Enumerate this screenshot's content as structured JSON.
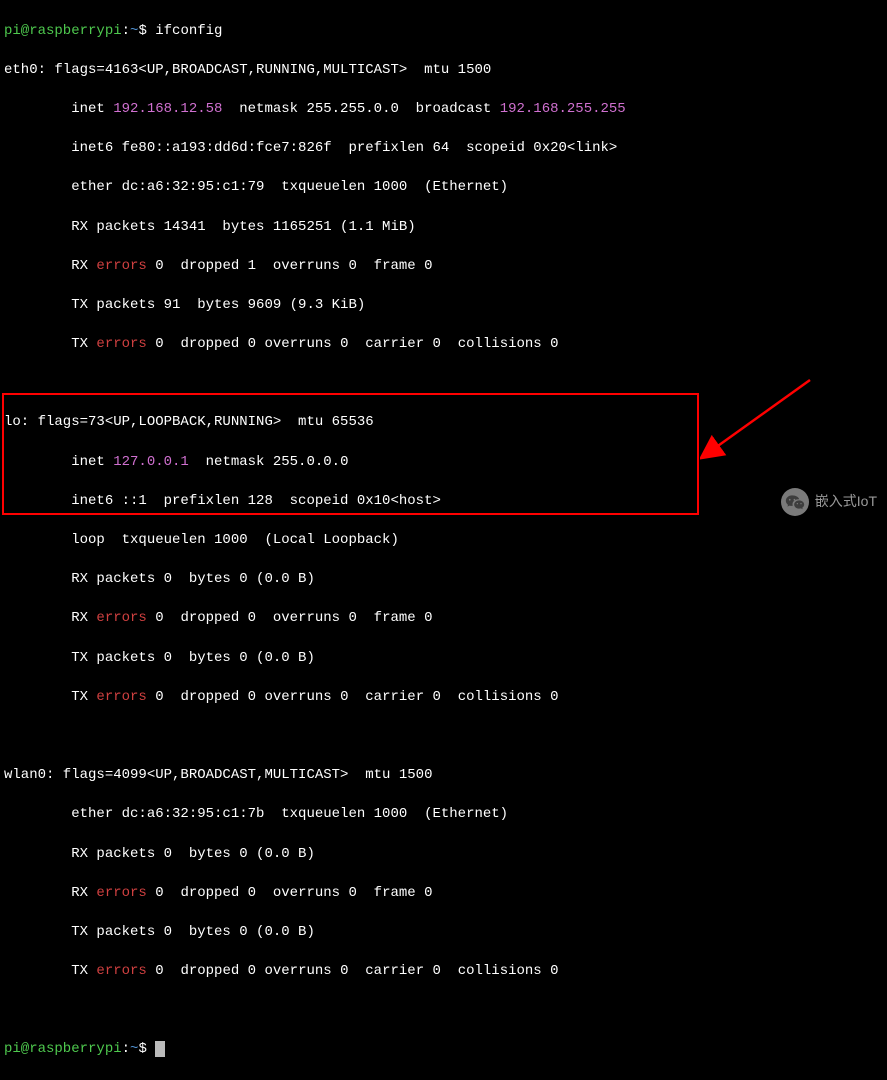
{
  "prompt1": {
    "user": "pi@raspberrypi",
    "sep": ":",
    "path": "~",
    "sym": "$",
    "cmd": " ifconfig"
  },
  "eth0": {
    "l1a": "eth0: flags=4163<UP,BROADCAST,RUNNING,MULTICAST>  mtu 1500",
    "l2a": "        inet ",
    "l2ip": "192.168.12.58",
    "l2b": "  netmask 255.255.0.0  broadcast ",
    "l2bc": "192.168.255.255",
    "l3": "        inet6 fe80::a193:dd6d:fce7:826f  prefixlen 64  scopeid 0x20<link>",
    "l4": "        ether dc:a6:32:95:c1:79  txqueuelen 1000  (Ethernet)",
    "l5": "        RX packets 14341  bytes 1165251 (1.1 MiB)",
    "l6a": "        RX ",
    "l6err": "errors",
    "l6b": " 0  dropped 1  overruns 0  frame 0",
    "l7": "        TX packets 91  bytes 9609 (9.3 KiB)",
    "l8a": "        TX ",
    "l8err": "errors",
    "l8b": " 0  dropped 0 overruns 0  carrier 0  collisions 0"
  },
  "lo": {
    "l1": "lo: flags=73<UP,LOOPBACK,RUNNING>  mtu 65536",
    "l2a": "        inet ",
    "l2ip": "127.0.0.1",
    "l2b": "  netmask 255.0.0.0",
    "l3": "        inet6 ::1  prefixlen 128  scopeid 0x10<host>",
    "l4": "        loop  txqueuelen 1000  (Local Loopback)",
    "l5": "        RX packets 0  bytes 0 (0.0 B)",
    "l6a": "        RX ",
    "l6err": "errors",
    "l6b": " 0  dropped 0  overruns 0  frame 0",
    "l7": "        TX packets 0  bytes 0 (0.0 B)",
    "l8a": "        TX ",
    "l8err": "errors",
    "l8b": " 0  dropped 0 overruns 0  carrier 0  collisions 0"
  },
  "wlan0": {
    "l1": "wlan0: flags=4099<UP,BROADCAST,MULTICAST>  mtu 1500",
    "l2": "        ether dc:a6:32:95:c1:7b  txqueuelen 1000  (Ethernet)",
    "l3": "        RX packets 0  bytes 0 (0.0 B)",
    "l4a": "        RX ",
    "l4err": "errors",
    "l4b": " 0  dropped 0  overruns 0  frame 0",
    "l5": "        TX packets 0  bytes 0 (0.0 B)",
    "l6a": "        TX ",
    "l6err": "errors",
    "l6b": " 0  dropped 0 overruns 0  carrier 0  collisions 0"
  },
  "prompt2": {
    "user": "pi@raspberrypi",
    "sep": ":",
    "path": "~",
    "sym": "$ "
  },
  "watermark": "嵌入式IoT"
}
